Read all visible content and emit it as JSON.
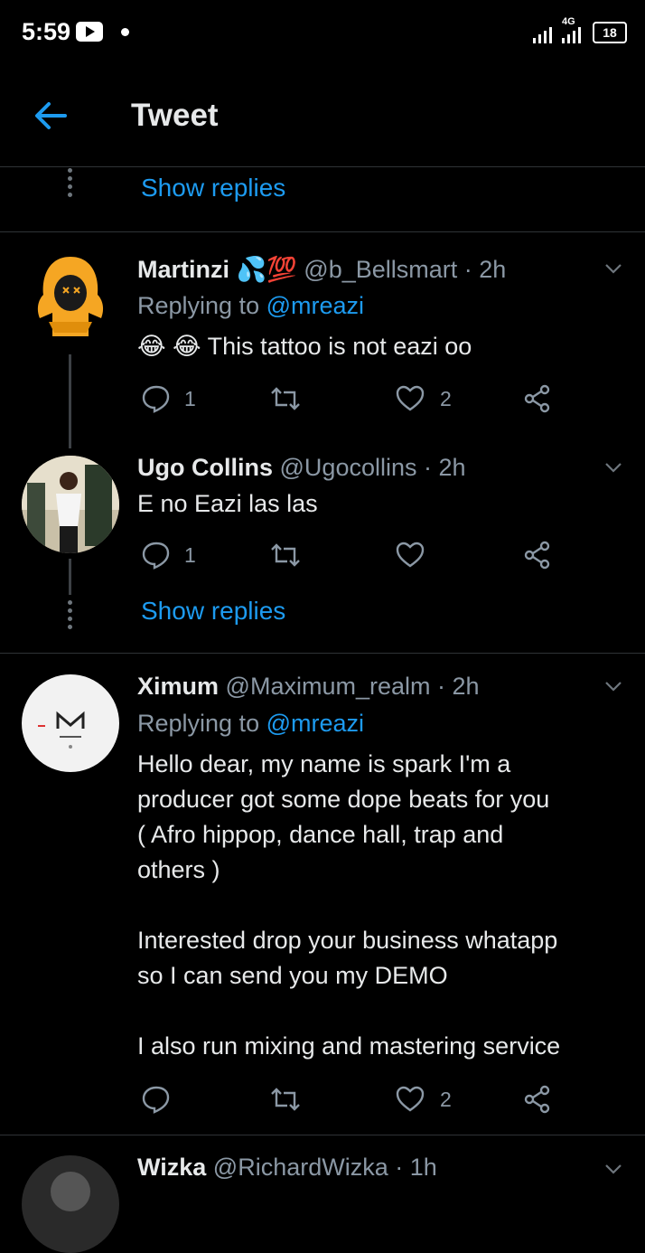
{
  "status_bar": {
    "time": "5:59",
    "network": "4G",
    "battery": "18"
  },
  "header": {
    "title": "Tweet"
  },
  "show_replies_label": "Show replies",
  "tweets": [
    {
      "name": "Martinzi",
      "emoji": "💦💯",
      "handle": "@b_Bellsmart",
      "time": "· 2h",
      "replying_prefix": "Replying to",
      "replying_to": "@mreazi",
      "text_emoji": "😂 😂",
      "text": "This tattoo is not eazi oo",
      "replies": "1",
      "likes": "2"
    },
    {
      "name": "Ugo Collins",
      "handle": "@Ugocollins",
      "time": "· 2h",
      "text": "E no Eazi las las",
      "replies": "1"
    },
    {
      "name": "Ximum",
      "handle": "@Maximum_realm",
      "time": "· 2h",
      "replying_prefix": "Replying to",
      "replying_to": "@mreazi",
      "text_lines": [
        "Hello dear, my name is spark I'm a",
        "producer got some dope beats for you",
        "( Afro hippop, dance hall, trap and",
        "others )",
        "",
        "Interested drop your business whatapp",
        "so I can send you my DEMO",
        "",
        "I also run mixing and mastering service"
      ],
      "likes": "2"
    },
    {
      "name": "Wizka",
      "handle": "@RichardWizka",
      "time": "· 1h"
    }
  ],
  "colors": {
    "accent": "#1d9bf0",
    "background": "#000000",
    "muted": "#8b98a5"
  }
}
